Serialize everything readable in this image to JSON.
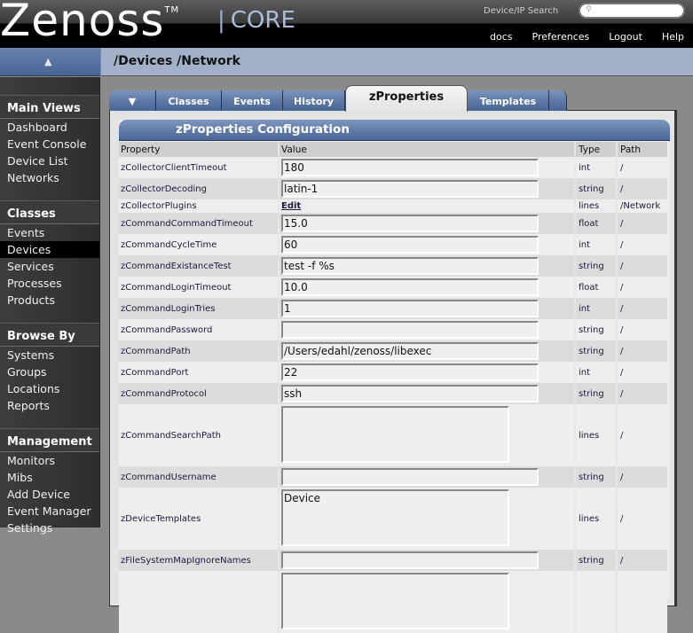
{
  "header": {
    "logo_text": "Zenoss",
    "logo_tm": "TM",
    "logo_pipe": "|",
    "logo_product": "CORE",
    "search_label": "Device/IP Search",
    "search_placeholder": "",
    "search_icon": "magnifier-icon",
    "links": [
      "docs",
      "Preferences",
      "Logout",
      "Help"
    ]
  },
  "breadcrumb": "/Devices /Network",
  "sidebar": {
    "collapse_icon": "triangle-up-icon",
    "sections": [
      {
        "title": "Main Views",
        "items": [
          "Dashboard",
          "Event Console",
          "Device List",
          "Networks"
        ]
      },
      {
        "title": "Classes",
        "items": [
          "Events",
          "Devices",
          "Services",
          "Processes",
          "Products"
        ]
      },
      {
        "title": "Browse By",
        "items": [
          "Systems",
          "Groups",
          "Locations",
          "Reports"
        ]
      },
      {
        "title": "Management",
        "items": [
          "Monitors",
          "Mibs",
          "Add Device",
          "Event Manager",
          "Settings"
        ]
      }
    ],
    "active_item": "Devices"
  },
  "tabs": {
    "menu_icon": "triangle-down-icon",
    "items": [
      "Classes",
      "Events",
      "History",
      "zProperties",
      "Templates"
    ],
    "active": "zProperties"
  },
  "config": {
    "title": "zProperties Configuration",
    "columns": [
      "Property",
      "Value",
      "Type",
      "Path"
    ],
    "rows": [
      {
        "property": "zCollectorClientTimeout",
        "value": "180",
        "kind": "input",
        "type": "int",
        "path": "/"
      },
      {
        "property": "zCollectorDecoding",
        "value": "latin-1",
        "kind": "input",
        "type": "string",
        "path": "/"
      },
      {
        "property": "zCollectorPlugins",
        "value": "Edit",
        "kind": "link",
        "type": "lines",
        "path": "/Network"
      },
      {
        "property": "zCommandCommandTimeout",
        "value": "15.0",
        "kind": "input",
        "type": "float",
        "path": "/"
      },
      {
        "property": "zCommandCycleTime",
        "value": "60",
        "kind": "input",
        "type": "int",
        "path": "/"
      },
      {
        "property": "zCommandExistanceTest",
        "value": "test -f %s",
        "kind": "input",
        "type": "string",
        "path": "/"
      },
      {
        "property": "zCommandLoginTimeout",
        "value": "10.0",
        "kind": "input",
        "type": "float",
        "path": "/"
      },
      {
        "property": "zCommandLoginTries",
        "value": "1",
        "kind": "input",
        "type": "int",
        "path": "/"
      },
      {
        "property": "zCommandPassword",
        "value": "",
        "kind": "input",
        "type": "string",
        "path": "/"
      },
      {
        "property": "zCommandPath",
        "value": "/Users/edahl/zenoss/libexec",
        "kind": "input",
        "type": "string",
        "path": "/"
      },
      {
        "property": "zCommandPort",
        "value": "22",
        "kind": "input",
        "type": "int",
        "path": "/"
      },
      {
        "property": "zCommandProtocol",
        "value": "ssh",
        "kind": "input",
        "type": "string",
        "path": "/"
      },
      {
        "property": "zCommandSearchPath",
        "value": "",
        "kind": "textarea",
        "type": "lines",
        "path": "/"
      },
      {
        "property": "zCommandUsername",
        "value": "",
        "kind": "input",
        "type": "string",
        "path": "/"
      },
      {
        "property": "zDeviceTemplates",
        "value": "Device",
        "kind": "textarea",
        "type": "lines",
        "path": "/"
      },
      {
        "property": "zFileSystemMapIgnoreNames",
        "value": "",
        "kind": "input",
        "type": "string",
        "path": "/"
      },
      {
        "property": "",
        "value": "",
        "kind": "textarea",
        "type": "",
        "path": ""
      }
    ]
  }
}
